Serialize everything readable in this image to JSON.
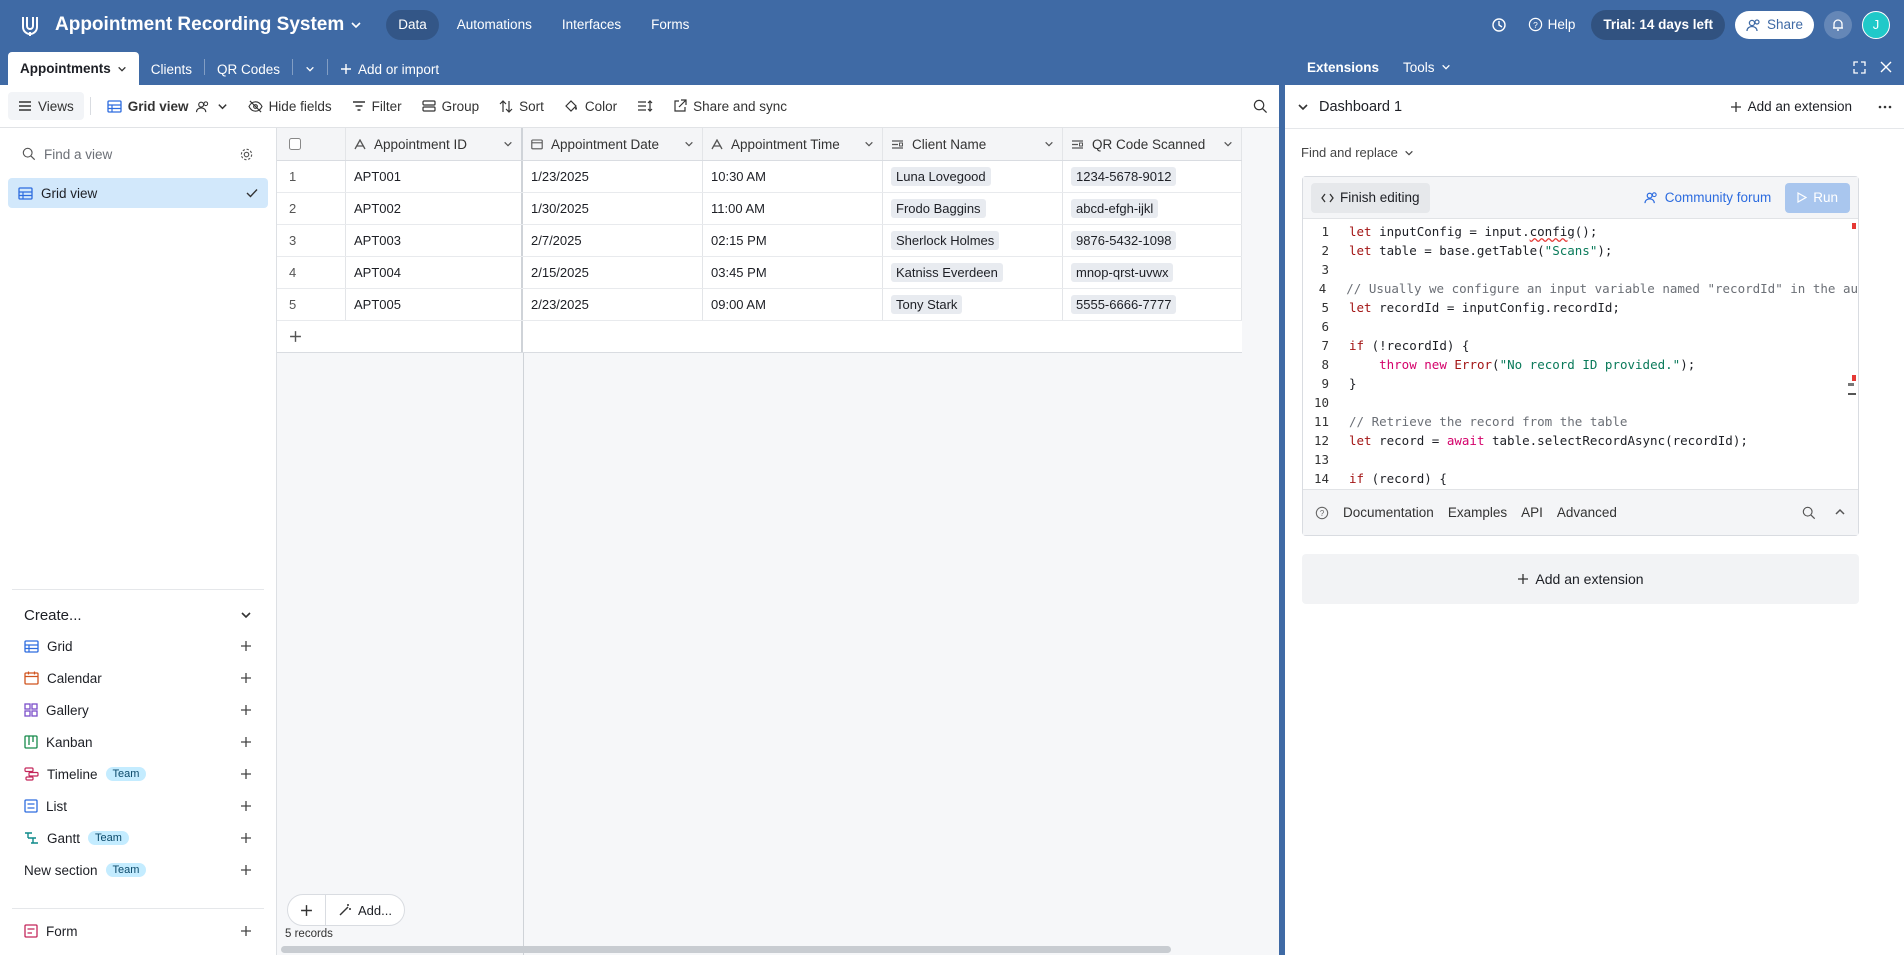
{
  "app": {
    "title": "Appointment Recording System",
    "nav": [
      "Data",
      "Automations",
      "Interfaces",
      "Forms"
    ],
    "help_label": "Help",
    "trial_label": "Trial: 14 days left",
    "share_label": "Share",
    "avatar_initial": "J"
  },
  "tabs": {
    "items": [
      "Appointments",
      "Clients",
      "QR Codes"
    ],
    "add_label": "Add or import"
  },
  "toolbar": {
    "views_label": "Views",
    "view_name": "Grid view",
    "hide_fields": "Hide fields",
    "filter": "Filter",
    "group": "Group",
    "sort": "Sort",
    "color": "Color",
    "share_sync": "Share and sync"
  },
  "sidebar": {
    "find_placeholder": "Find a view",
    "active_view": "Grid view",
    "create_label": "Create...",
    "create_items": [
      {
        "label": "Grid",
        "team": "",
        "color": "#2d6cdf"
      },
      {
        "label": "Calendar",
        "team": "",
        "color": "#d0541f"
      },
      {
        "label": "Gallery",
        "team": "",
        "color": "#7b4ec9"
      },
      {
        "label": "Kanban",
        "team": "",
        "color": "#168a4a"
      },
      {
        "label": "Timeline",
        "team": "Team",
        "color": "#c3265a"
      },
      {
        "label": "List",
        "team": "",
        "color": "#2d6cdf"
      },
      {
        "label": "Gantt",
        "team": "Team",
        "color": "#0f8a8a"
      }
    ],
    "new_section": "New section",
    "new_section_team": "Team",
    "form_label": "Form"
  },
  "grid": {
    "columns": [
      "Appointment ID",
      "Appointment Date",
      "Appointment Time",
      "Client Name",
      "QR Code Scanned"
    ],
    "rows": [
      {
        "n": "1",
        "id": "APT001",
        "date": "1/23/2025",
        "time": "10:30 AM",
        "client": "Luna Lovegood",
        "qr": "1234-5678-9012"
      },
      {
        "n": "2",
        "id": "APT002",
        "date": "1/30/2025",
        "time": "11:00 AM",
        "client": "Frodo Baggins",
        "qr": "abcd-efgh-ijkl"
      },
      {
        "n": "3",
        "id": "APT003",
        "date": "2/7/2025",
        "time": "02:15 PM",
        "client": "Sherlock Holmes",
        "qr": "9876-5432-1098"
      },
      {
        "n": "4",
        "id": "APT004",
        "date": "2/15/2025",
        "time": "03:45 PM",
        "client": "Katniss Everdeen",
        "qr": "mnop-qrst-uvwx"
      },
      {
        "n": "5",
        "id": "APT005",
        "date": "2/23/2025",
        "time": "09:00 AM",
        "client": "Tony Stark",
        "qr": "5555-6666-7777"
      }
    ],
    "add_label": "Add...",
    "record_count": "5 records"
  },
  "extensions": {
    "tab_extensions": "Extensions",
    "tab_tools": "Tools",
    "dashboard_title": "Dashboard 1",
    "add_extension": "Add an extension",
    "find_replace": "Find and replace",
    "finish_editing": "Finish editing",
    "community_forum": "Community forum",
    "run": "Run",
    "bottom_tabs": [
      "Documentation",
      "Examples",
      "API",
      "Advanced"
    ],
    "code_lines": [
      "let inputConfig = input.config();",
      "let table = base.getTable(\"Scans\");",
      "",
      "// Usually we configure an input variable named \"recordId\" in the au",
      "let recordId = inputConfig.recordId;",
      "",
      "if (!recordId) {",
      "    throw new Error(\"No record ID provided.\");",
      "}",
      "",
      "// Retrieve the record from the table",
      "let record = await table.selectRecordAsync(recordId);",
      "",
      "if (record) {"
    ]
  }
}
